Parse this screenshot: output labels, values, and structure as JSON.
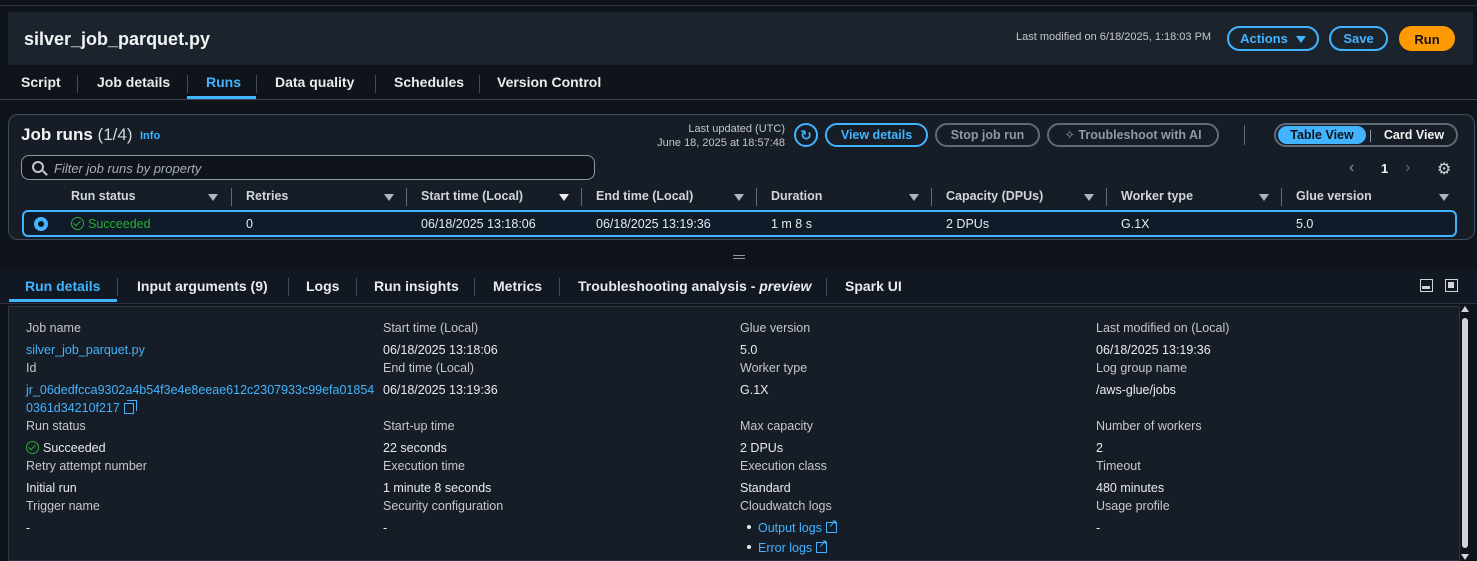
{
  "header": {
    "title": "silver_job_parquet.py",
    "last_modified": "Last modified on 6/18/2025, 1:18:03 PM",
    "actions_label": "Actions",
    "save_label": "Save",
    "run_label": "Run"
  },
  "main_tabs": [
    "Script",
    "Job details",
    "Runs",
    "Data quality",
    "Schedules",
    "Version Control"
  ],
  "main_tab_active": "Runs",
  "job_runs": {
    "title": "Job runs",
    "count": "(1/4)",
    "info": "Info",
    "last_updated_label": "Last updated (UTC)",
    "last_updated_value": "June 18, 2025 at 18:57:48",
    "view_details": "View details",
    "stop_job_run": "Stop job run",
    "troubleshoot": "Troubleshoot with AI",
    "table_view": "Table View",
    "card_view": "Card View",
    "search_placeholder": "Filter job runs by property",
    "page": "1",
    "columns": [
      "Run status",
      "Retries",
      "Start time (Local)",
      "End time (Local)",
      "Duration",
      "Capacity (DPUs)",
      "Worker type",
      "Glue version"
    ],
    "row": {
      "status": "Succeeded",
      "retries": "0",
      "start": "06/18/2025 13:18:06",
      "end": "06/18/2025 13:19:36",
      "duration": "1 m 8 s",
      "capacity": "2 DPUs",
      "worker": "G.1X",
      "glue": "5.0"
    }
  },
  "detail_tabs": {
    "run_details": "Run details",
    "input_arguments": "Input arguments (9)",
    "logs": "Logs",
    "run_insights": "Run insights",
    "metrics": "Metrics",
    "troubleshooting_prefix": "Troubleshooting analysis - ",
    "troubleshooting_preview": "preview",
    "spark_ui": "Spark UI"
  },
  "details": {
    "job_name_label": "Job name",
    "job_name_value": "silver_job_parquet.py",
    "id_label": "Id",
    "id_value_line1": "jr_06dedfcca9302a4b54f3e4e8eeae612c2307933c99efa01854",
    "id_value_line2": "0361d34210f217",
    "run_status_label": "Run status",
    "run_status_value": "Succeeded",
    "retry_label": "Retry attempt number",
    "retry_value": "Initial run",
    "trigger_label": "Trigger name",
    "trigger_value": "-",
    "start_label": "Start time (Local)",
    "start_value": "06/18/2025 13:18:06",
    "end_label": "End time (Local)",
    "end_value": "06/18/2025 13:19:36",
    "startup_label": "Start-up time",
    "startup_value": "22 seconds",
    "exec_label": "Execution time",
    "exec_value": "1 minute 8 seconds",
    "security_label": "Security configuration",
    "security_value": "-",
    "glue_label": "Glue version",
    "glue_value": "5.0",
    "worker_label": "Worker type",
    "worker_value": "G.1X",
    "maxcap_label": "Max capacity",
    "maxcap_value": "2 DPUs",
    "execclass_label": "Execution class",
    "execclass_value": "Standard",
    "cw_label": "Cloudwatch logs",
    "output_logs": "Output logs",
    "error_logs": "Error logs",
    "lastmod_label": "Last modified on (Local)",
    "lastmod_value": "06/18/2025 13:19:36",
    "loggroup_label": "Log group name",
    "loggroup_value": "/aws-glue/jobs",
    "workers_label": "Number of workers",
    "workers_value": "2",
    "timeout_label": "Timeout",
    "timeout_value": "480 minutes",
    "usage_label": "Usage profile",
    "usage_value": "-"
  },
  "colors": {
    "accent": "#42b4ff",
    "run_button": "#ff9900",
    "success": "#29ad32",
    "background": "#0f141a"
  }
}
